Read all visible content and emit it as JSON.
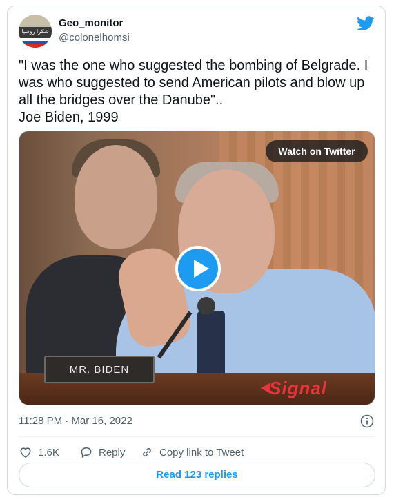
{
  "author": {
    "display_name": "Geo_monitor",
    "username": "@colonelhomsi",
    "avatar_text": "شكرا روسيا"
  },
  "tweet": {
    "text": "\"I was the one who suggested the bombing of Belgrade. I was who suggested to send American pilots and blow up all the bridges over the Danube\"..\nJoe Biden, 1999",
    "timestamp": "11:28 PM · Mar 16, 2022"
  },
  "media": {
    "watch_label": "Watch on Twitter",
    "nameplate": "MR. BIDEN",
    "watermark": "Signal",
    "play_icon": "play-icon"
  },
  "actions": {
    "likes": "1.6K",
    "reply_label": "Reply",
    "copy_label": "Copy link to Tweet"
  },
  "read_replies": "Read 123 replies",
  "icons": {
    "brand": "twitter-bird-icon",
    "info": "info-icon",
    "like": "heart-icon",
    "reply": "reply-bubble-icon",
    "copy": "link-icon"
  },
  "colors": {
    "accent": "#1d9bf0",
    "secondary_text": "#536471",
    "border": "#cfd9de"
  }
}
